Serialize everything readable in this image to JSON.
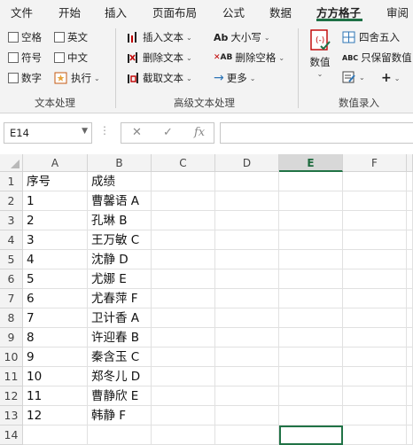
{
  "ribbon_tabs": [
    "文件",
    "开始",
    "插入",
    "页面布局",
    "公式",
    "数据",
    "方方格子",
    "审阅"
  ],
  "active_tab": "方方格子",
  "text_group": {
    "checkboxes": [
      "空格",
      "英文",
      "符号",
      "中文",
      "数字"
    ],
    "exec_label": "执行",
    "label": "文本处理"
  },
  "advanced_group": {
    "insert_text": "插入文本",
    "delete_text": "删除文本",
    "extract_text": "截取文本",
    "case_label": "大小写",
    "delete_spaces": "删除空格",
    "more_label": "更多",
    "label": "高级文本处理"
  },
  "number_group": {
    "number_label": "数值",
    "round_label": "四舍五入",
    "keep_value": "只保留数值",
    "label": "数值录入"
  },
  "formula_bar": {
    "name_box": "E14",
    "cancel_icon": "✕",
    "enter_icon": "✓",
    "fx_label": "fx",
    "formula": ""
  },
  "sheet": {
    "columns": [
      "A",
      "B",
      "C",
      "D",
      "E",
      "F"
    ],
    "selected_column": "E",
    "selected_cell": "E14",
    "rows": [
      {
        "num": "1",
        "a": "序号",
        "b": "成绩"
      },
      {
        "num": "2",
        "a": "1",
        "b": "曹馨语 A"
      },
      {
        "num": "3",
        "a": "2",
        "b": "孔琳 B"
      },
      {
        "num": "4",
        "a": "3",
        "b": "王万敏 C"
      },
      {
        "num": "5",
        "a": "4",
        "b": "沈静 D"
      },
      {
        "num": "6",
        "a": "5",
        "b": "尤娜 E"
      },
      {
        "num": "7",
        "a": "6",
        "b": "尤春萍 F"
      },
      {
        "num": "8",
        "a": "7",
        "b": "卫计香 A"
      },
      {
        "num": "9",
        "a": "8",
        "b": "许迎春 B"
      },
      {
        "num": "10",
        "a": "9",
        "b": "秦含玉 C"
      },
      {
        "num": "11",
        "a": "10",
        "b": "郑冬儿 D"
      },
      {
        "num": "12",
        "a": "11",
        "b": "曹静欣 E"
      },
      {
        "num": "13",
        "a": "12",
        "b": "韩静 F"
      },
      {
        "num": "14",
        "a": "",
        "b": ""
      }
    ]
  },
  "colors": {
    "accent": "#217346",
    "ribbon_bg": "#f3f3f3",
    "header_bg": "#f3f3f3",
    "grid": "#e1e1e1"
  }
}
